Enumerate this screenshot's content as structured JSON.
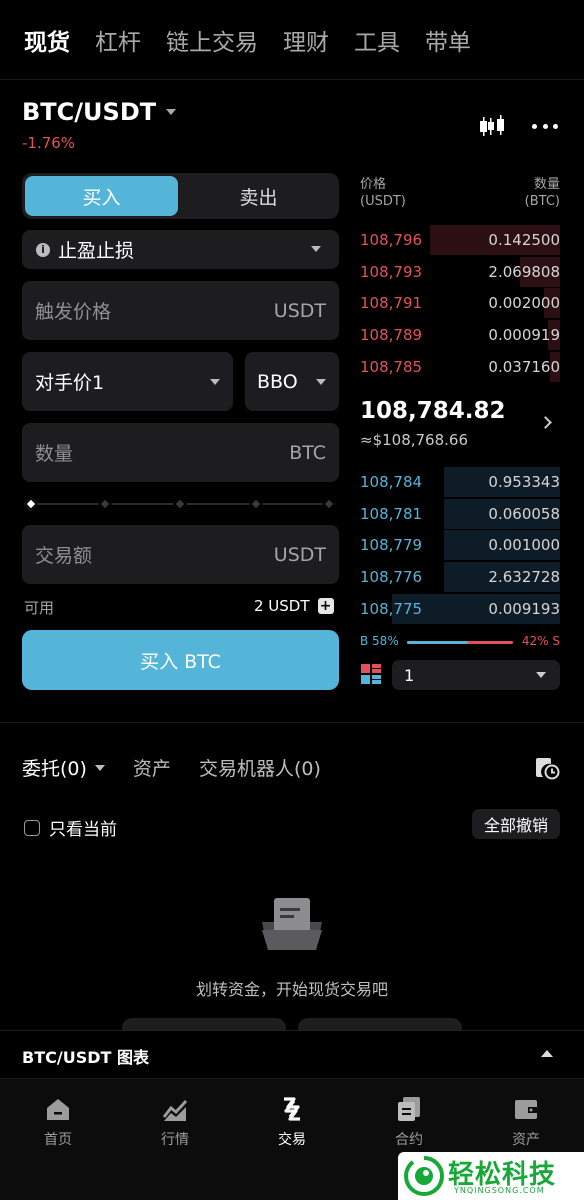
{
  "top_tabs": [
    "现货",
    "杠杆",
    "链上交易",
    "理财",
    "工具",
    "带单"
  ],
  "pair": {
    "symbol": "BTC/USDT",
    "change": "-1.76%"
  },
  "trade": {
    "buy_label": "买入",
    "sell_label": "卖出",
    "order_type": "止盈止损",
    "trigger_placeholder": "触发价格",
    "trigger_unit": "USDT",
    "price_type": "对手价1",
    "bbo_label": "BBO",
    "qty_placeholder": "数量",
    "qty_unit": "BTC",
    "amount_placeholder": "交易额",
    "amount_unit": "USDT",
    "available_label": "可用",
    "available_value": "2 USDT",
    "submit_label": "买入 BTC",
    "slider_percent": 0
  },
  "orderbook": {
    "price_header": "价格",
    "price_unit": "(USDT)",
    "qty_header": "数量",
    "qty_unit": "(BTC)",
    "asks": [
      {
        "price": "108,796",
        "qty": "0.142500",
        "depth": 0.65
      },
      {
        "price": "108,793",
        "qty": "2.069808",
        "depth": 0.2
      },
      {
        "price": "108,791",
        "qty": "0.002000",
        "depth": 0.08
      },
      {
        "price": "108,789",
        "qty": "0.000919",
        "depth": 0.06
      },
      {
        "price": "108,785",
        "qty": "0.037160",
        "depth": 0.05
      }
    ],
    "mid_price": "108,784.82",
    "mid_usd": "≈$108,768.66",
    "bids": [
      {
        "price": "108,784",
        "qty": "0.953343",
        "depth": 0.58
      },
      {
        "price": "108,781",
        "qty": "0.060058",
        "depth": 0.58
      },
      {
        "price": "108,779",
        "qty": "0.001000",
        "depth": 0.58
      },
      {
        "price": "108,776",
        "qty": "2.632728",
        "depth": 0.58
      },
      {
        "price": "108,775",
        "qty": "0.009193",
        "depth": 0.84
      }
    ],
    "buy_ratio_label": "B 58%",
    "sell_ratio_label": "42% S",
    "buy_ratio": 58,
    "depth_value": "1"
  },
  "orders": {
    "tabs": [
      "委托(0)",
      "资产",
      "交易机器人(0)"
    ],
    "only_current": "只看当前",
    "cancel_all": "全部撤销",
    "empty_text": "划转资金，开始现货交易吧"
  },
  "chart_bar": {
    "title": "BTC/USDT 图表"
  },
  "bottom_nav": [
    "首页",
    "行情",
    "交易",
    "合约",
    "资产"
  ],
  "watermark": {
    "text": "轻松科技",
    "sub": "YNQINGSONG.COM"
  },
  "colors": {
    "accent": "#54b5d9",
    "ask": "#e4515a",
    "bg": "#000000",
    "panel": "#1d1d1f"
  }
}
